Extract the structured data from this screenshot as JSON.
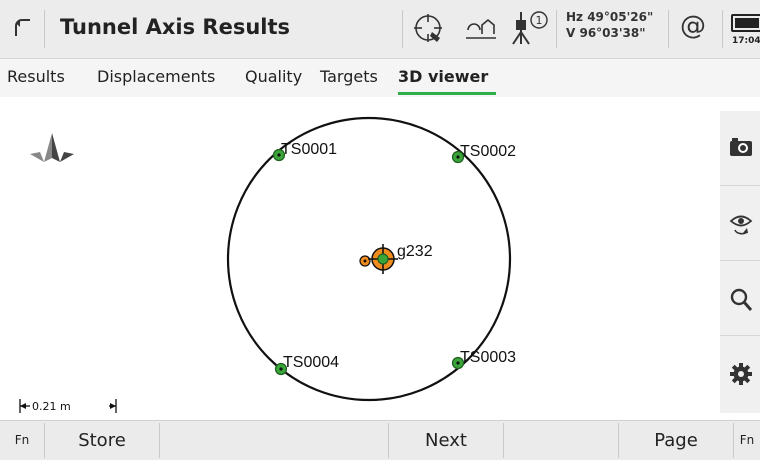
{
  "header": {
    "title": "Tunnel Axis Results",
    "hz": "Hz 49°05'26\"",
    "v": "V  96°03'38\"",
    "at_symbol": "@",
    "time": "17:04",
    "icons": [
      "back-icon",
      "target-search-icon",
      "reflectorless-icon",
      "instrument-face-icon",
      "battery-icon"
    ],
    "instrument_badge": "1"
  },
  "tabs": [
    {
      "label": "Results",
      "active": false
    },
    {
      "label": "Displacements",
      "active": false
    },
    {
      "label": "Quality",
      "active": false
    },
    {
      "label": "Targets",
      "active": false
    },
    {
      "label": "3D viewer",
      "active": true
    }
  ],
  "viewer": {
    "points": [
      {
        "label": "TS0001"
      },
      {
        "label": "TS0002"
      },
      {
        "label": "TS0003"
      },
      {
        "label": "TS0004"
      },
      {
        "label": "g232"
      }
    ],
    "scale_label": "0.21 m",
    "colors": {
      "point_green": "#3aa63a",
      "target_orange": "#f08c1e",
      "circle": "#111111"
    }
  },
  "sidebar": {
    "buttons": [
      "camera-icon",
      "view-rotate-icon",
      "zoom-icon",
      "settings-icon"
    ]
  },
  "softkeys": {
    "fn_left": "Fn",
    "store": "Store",
    "next": "Next",
    "page": "Page",
    "fn_right": "Fn"
  }
}
